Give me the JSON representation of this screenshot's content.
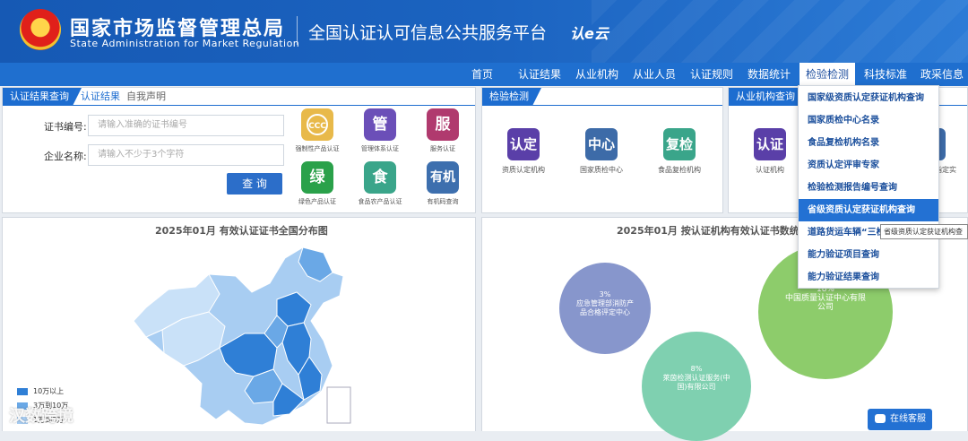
{
  "header": {
    "org_cn": "国家市场监督管理总局",
    "org_en": "State Administration  for  Market Regulation",
    "platform": "全国认证认可信息公共服务平台",
    "platform_logo": "认e云"
  },
  "nav": [
    "首页",
    "认证结果",
    "从业机构",
    "从业人员",
    "认证规则",
    "数据统计",
    "检验检测",
    "科技标准",
    "政采信息"
  ],
  "nav_active": "检验检测",
  "cert_panel": {
    "tab_active": "认证结果查询",
    "tab2": "认证结果",
    "tab3": "自我声明",
    "cert_no_label": "证书编号:",
    "cert_no_placeholder": "请输入准确的证书编号",
    "company_label": "企业名称:",
    "company_placeholder": "请输入不少于3个字符",
    "query_button": "查 询",
    "types": [
      {
        "icon_text": "",
        "icon": "ccc-icon",
        "label": "强制性产品认证",
        "color": "#e8b94a"
      },
      {
        "icon_text": "管",
        "icon": "guan-icon",
        "label": "管理体系认证",
        "color": "#6b4fb8"
      },
      {
        "icon_text": "服",
        "icon": "fu-icon",
        "label": "服务认证",
        "color": "#b03a6e"
      },
      {
        "icon_text": "绿",
        "icon": "lv-icon",
        "label": "绿色产品认证",
        "color": "#2aa14a"
      },
      {
        "icon_text": "食",
        "icon": "shi-icon",
        "label": "食品农产品认证",
        "color": "#3aa58a"
      },
      {
        "icon_text": "有机",
        "icon": "youji-icon",
        "label": "有机码查询",
        "color": "#3d6fae"
      }
    ]
  },
  "test_panel": {
    "tab": "检验检测",
    "items": [
      {
        "icon_text": "认定",
        "label": "资质认定机构",
        "color": "#5a3fa8"
      },
      {
        "icon_text": "中心",
        "label": "国家质检中心",
        "color": "#3d6ba8"
      },
      {
        "icon_text": "复检",
        "label": "食品复检机构",
        "color": "#3aa58a"
      }
    ]
  },
  "org_panel": {
    "tab": "从业机构查询",
    "items": [
      {
        "icon_text": "认证",
        "label": "认证机构",
        "color": "#5a3fa8"
      }
    ],
    "partial_label": "指定实"
  },
  "dropdown": {
    "items": [
      "国家级资质认定获证机构查询",
      "国家质检中心名录",
      "食品复检机构名录",
      "资质认定评审专家",
      "检验检测报告编号查询",
      "省级资质认定获证机构查询",
      "道路货运车辆“三检”",
      "能力验证项目查询",
      "能力验证结果查询"
    ],
    "highlighted": "省级资质认定获证机构查询",
    "tooltip": "省级资质认定获证机构查"
  },
  "map_chart": {
    "title": "2025年01月  有效认证证书全国分布图",
    "legend": [
      {
        "label": "10万以上",
        "color": "#2f7fd6"
      },
      {
        "label": "3万到10万",
        "color": "#6aa8e6"
      },
      {
        "label": "1万到3万",
        "color": "#a8cdf2"
      }
    ]
  },
  "chart_data": {
    "type": "bubble",
    "title": "2025年01月  按认证机构有效认证书数统计",
    "series": [
      {
        "name": "中国质量认证中心有限公司",
        "percent": 18,
        "color": "#8dcc6b"
      },
      {
        "name": "应急管理部消防产品合格评定中心",
        "percent": 3,
        "color": "#8796cc"
      },
      {
        "name": "莱茵检测认证服务(中国)有限公司",
        "percent": 8,
        "color": "#7fd0b0"
      }
    ]
  },
  "watermark": "汉数跨境",
  "online_service": "在线客服"
}
